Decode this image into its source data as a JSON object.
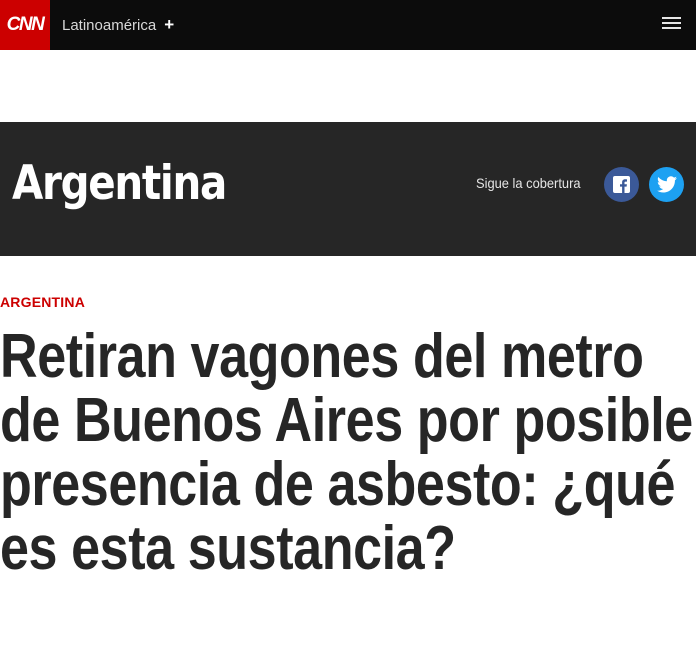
{
  "header": {
    "logo_text": "CNN",
    "edition_label": "Latinoamérica",
    "edition_toggle": "+",
    "menu_icon": "hamburger-menu-icon"
  },
  "section": {
    "title": "Argentina",
    "follow_label": "Sigue la cobertura",
    "facebook_icon": "facebook-icon",
    "twitter_icon": "twitter-icon"
  },
  "article": {
    "kicker": "ARGENTINA",
    "headline": "Retiran vagones del metro de Buenos Aires por posible presencia de asbesto: ¿qué es esta sustancia?"
  },
  "colors": {
    "brand_red": "#cc0000",
    "top_bar": "#0c0c0c",
    "banner_bg": "#262626",
    "facebook_blue": "#3b5998",
    "twitter_blue": "#1da1f2"
  }
}
